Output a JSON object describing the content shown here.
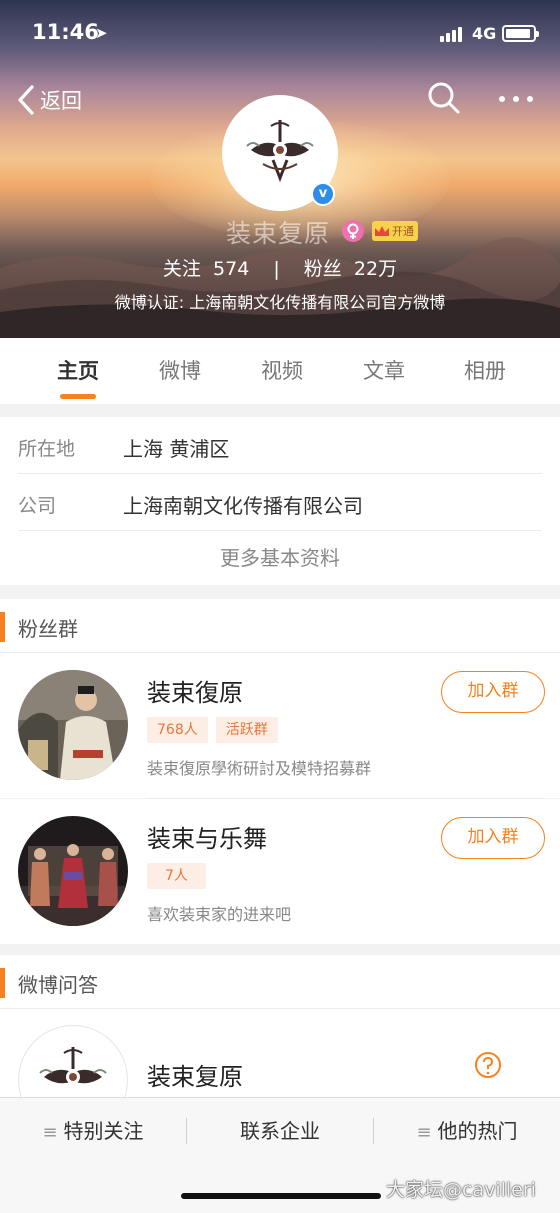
{
  "status_bar": {
    "time": "11:46",
    "network": "4G"
  },
  "nav": {
    "back_label": "返回"
  },
  "profile": {
    "name": "装束复原",
    "vip_label": "开通",
    "following_label": "关注",
    "following_count": "574",
    "followers_label": "粉丝",
    "followers_count": "22万",
    "verification": "微博认证: 上海南朝文化传播有限公司官方微博"
  },
  "tabs": [
    {
      "label": "主页",
      "active": true
    },
    {
      "label": "微博",
      "active": false
    },
    {
      "label": "视频",
      "active": false
    },
    {
      "label": "文章",
      "active": false
    },
    {
      "label": "相册",
      "active": false
    }
  ],
  "info": {
    "rows": [
      {
        "label": "所在地",
        "value": "上海 黄浦区"
      },
      {
        "label": "公司",
        "value": "上海南朝文化传播有限公司"
      }
    ],
    "more_label": "更多基本资料"
  },
  "fan_groups": {
    "title": "粉丝群",
    "groups": [
      {
        "name": "装束復原",
        "tags": [
          "768人",
          "活跃群"
        ],
        "description": "装束復原學術研討及模特招募群",
        "join_label": "加入群"
      },
      {
        "name": "装束与乐舞",
        "tags": [
          "7人"
        ],
        "description": "喜欢装束家的进来吧",
        "join_label": "加入群"
      }
    ]
  },
  "qa": {
    "title": "微博问答",
    "name": "装束复原"
  },
  "bottom_bar": {
    "items": [
      "特别关注",
      "联系企业",
      "他的热门"
    ]
  },
  "watermark": "大家坛@cavilleri",
  "colors": {
    "accent": "#f5821f",
    "verified": "#2e8de6",
    "tag_bg": "#fdeee5"
  }
}
